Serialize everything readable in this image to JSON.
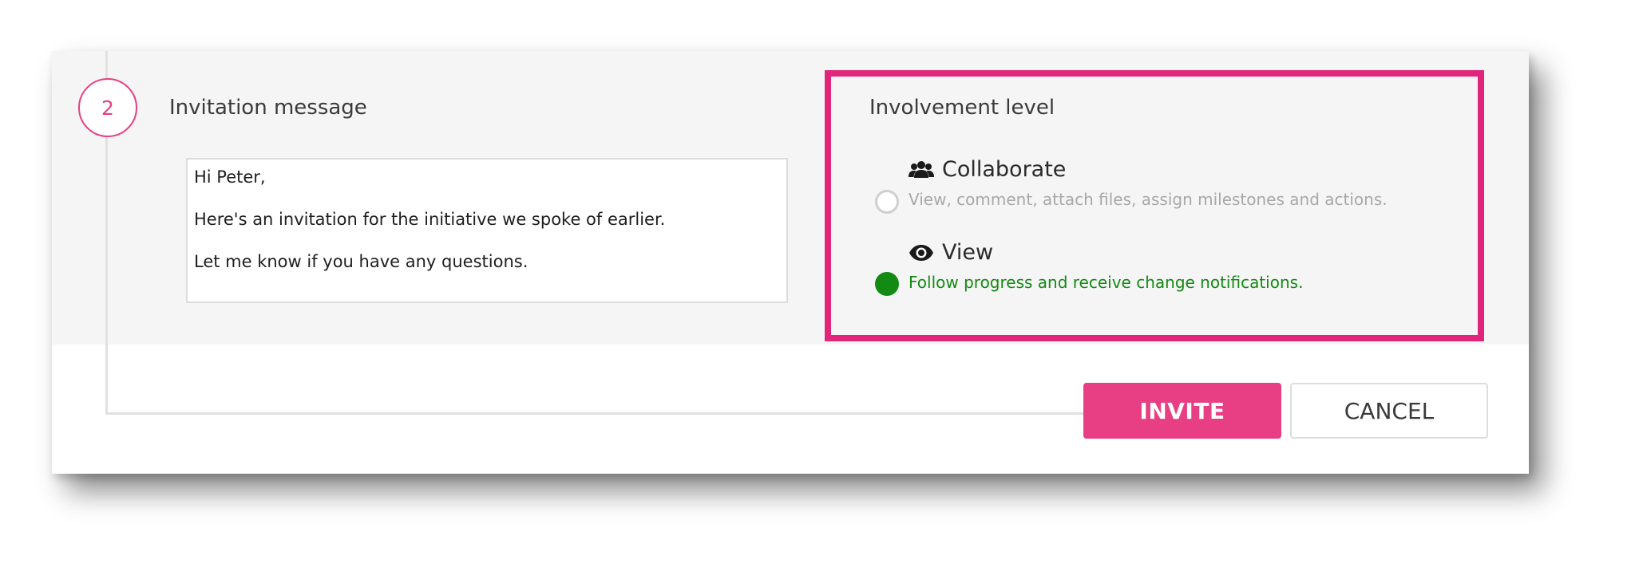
{
  "step": {
    "number": "2"
  },
  "invitation": {
    "title": "Invitation message",
    "lines": [
      "Hi Peter,",
      "Here's an invitation for the initiative we spoke of earlier.",
      "Let me know if you have any questions."
    ]
  },
  "involvement": {
    "title": "Involvement level",
    "highlight_color": "#e0257a",
    "options": [
      {
        "icon": "users-icon",
        "label": "Collaborate",
        "description": "View, comment, attach files, assign milestones and actions.",
        "selected": false,
        "description_color": "#a8a8a8"
      },
      {
        "icon": "eye-icon",
        "label": "View",
        "description": "Follow progress and receive change notifications.",
        "selected": true,
        "description_color": "#138a13"
      }
    ]
  },
  "buttons": {
    "invite_label": "INVITE",
    "cancel_label": "CANCEL"
  },
  "colors": {
    "accent": "#e83e84",
    "selected_green": "#138a13"
  }
}
